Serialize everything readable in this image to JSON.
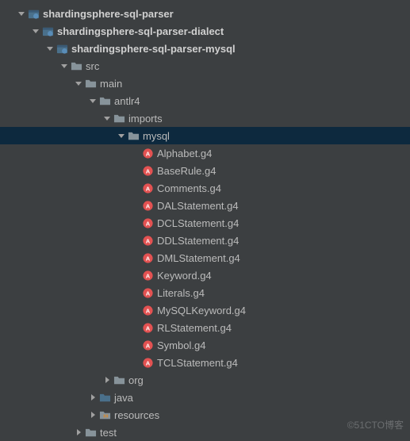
{
  "tree": {
    "n0": "shardingsphere-sql-parser",
    "n1": "shardingsphere-sql-parser-dialect",
    "n2": "shardingsphere-sql-parser-mysql",
    "n3": "src",
    "n4": "main",
    "n5": "antlr4",
    "n6": "imports",
    "n7": "mysql",
    "files": {
      "f0": "Alphabet.g4",
      "f1": "BaseRule.g4",
      "f2": "Comments.g4",
      "f3": "DALStatement.g4",
      "f4": "DCLStatement.g4",
      "f5": "DDLStatement.g4",
      "f6": "DMLStatement.g4",
      "f7": "Keyword.g4",
      "f8": "Literals.g4",
      "f9": "MySQLKeyword.g4",
      "f10": "RLStatement.g4",
      "f11": "Symbol.g4",
      "f12": "TCLStatement.g4"
    },
    "n8": "org",
    "n9": "java",
    "n10": "resources",
    "n11": "test"
  },
  "watermark": "©51CTO博客"
}
